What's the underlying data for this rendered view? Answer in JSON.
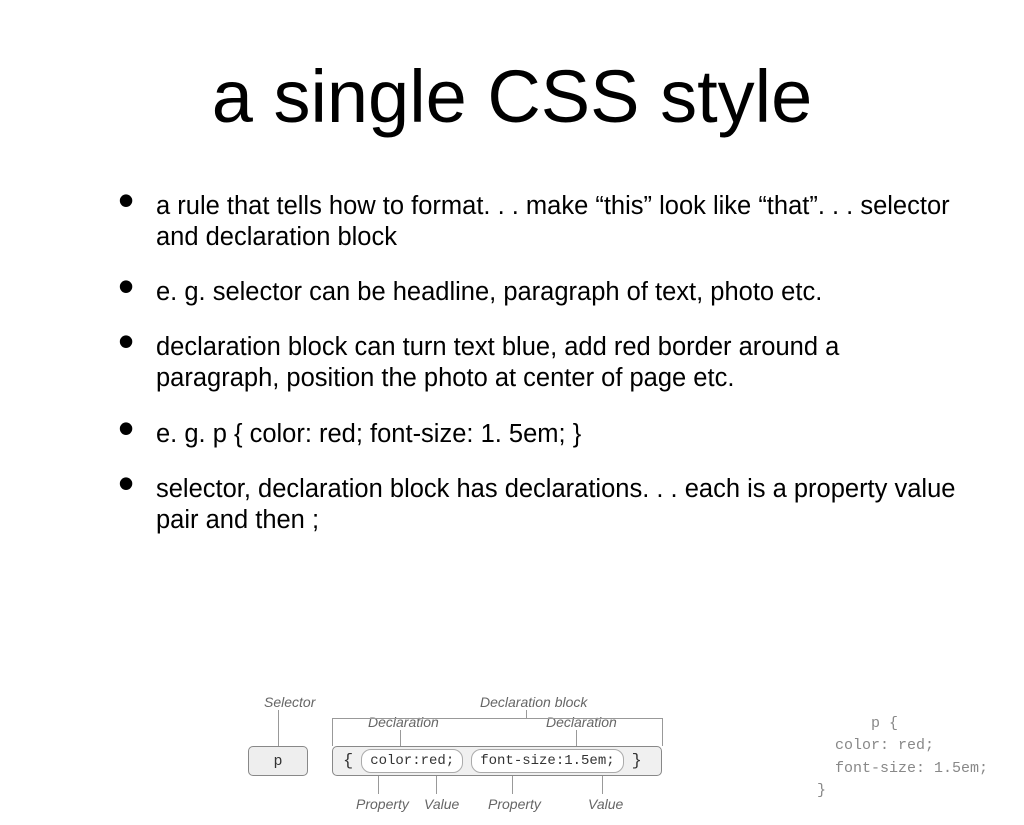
{
  "title": "a single CSS style",
  "bullets": [
    "a rule that tells how to format. . . make “this” look like “that”. . . selector and declaration block",
    "e. g. selector can be headline, paragraph of text, photo etc.",
    "declaration block can turn text blue, add red border around a paragraph, position the photo at center of page etc.",
    "e. g. p { color: red; font-size: 1. 5em; }",
    "selector, declaration block has declarations. . . each is a property value pair and then ;"
  ],
  "diagram": {
    "labels": {
      "selector": "Selector",
      "declaration_block": "Declaration block",
      "declaration1": "Declaration",
      "declaration2": "Declaration",
      "property1": "Property",
      "value1": "Value",
      "property2": "Property",
      "value2": "Value"
    },
    "selector_box": "p",
    "brace_open": "{",
    "brace_close": "}",
    "pill1": "color:red;",
    "pill2": "font-size:1.5em;"
  },
  "code_sample": {
    "line1": "p {",
    "line2": "color: red;",
    "line3": "font-size: 1.5em;",
    "line4": "}"
  }
}
